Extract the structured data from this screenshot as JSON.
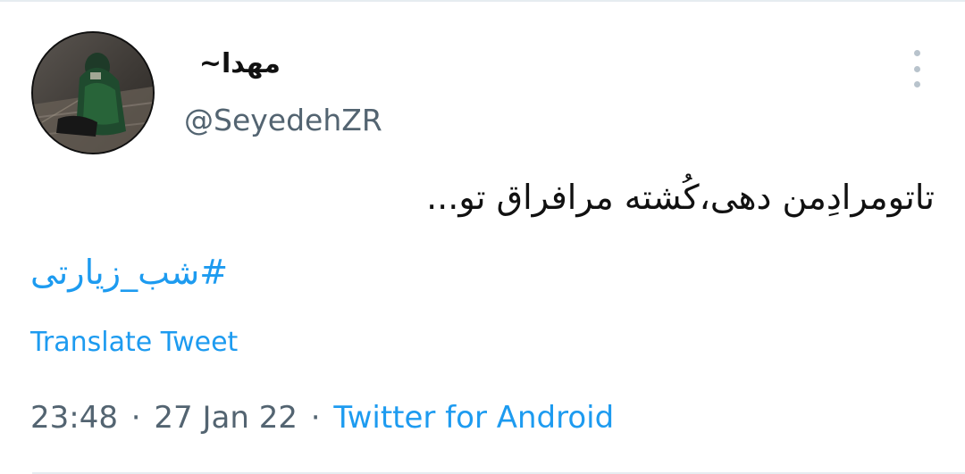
{
  "tweet": {
    "display_name": "مهدا~",
    "handle": "@SeyedehZR",
    "text": "تاتومرادِمن دهی،کُشته مرافراق تو...",
    "hashtag": "#شب_زیارتی",
    "translate_label": "Translate Tweet",
    "time": "23:48",
    "date": "27 Jan 22",
    "separator": "·",
    "source": "Twitter for Android"
  },
  "icons": {
    "more": "vertical-ellipsis-icon",
    "avatar": "profile-avatar"
  },
  "colors": {
    "link": "#1d9bf0",
    "secondary": "#536471",
    "text": "#111111",
    "more_icon": "#b8c3cc"
  }
}
